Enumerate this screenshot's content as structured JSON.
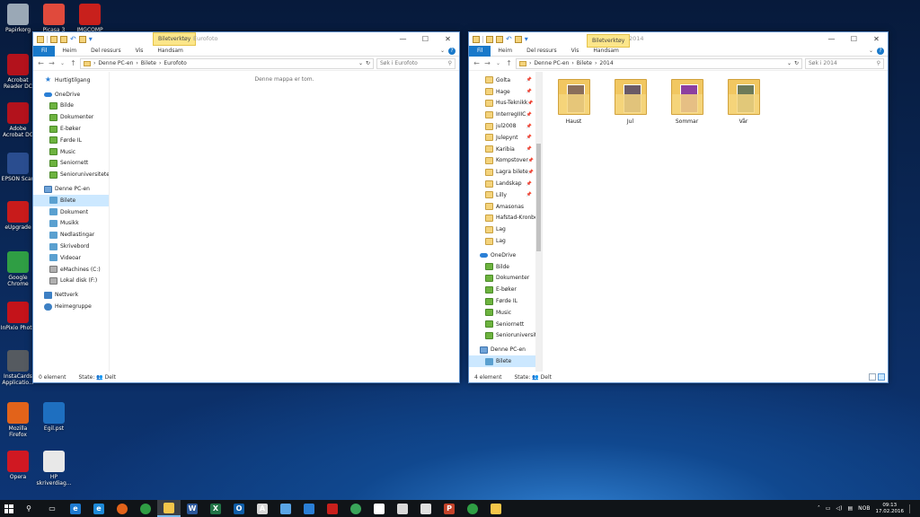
{
  "desktop": {
    "icons": [
      {
        "label": "Papirkorg",
        "color": "#9aa8b6"
      },
      {
        "label": "Picasa 3",
        "color": "#e04a3c"
      },
      {
        "label": "IMGCOMP",
        "color": "#c8201c"
      },
      {
        "label": "Acrobat Reader DC",
        "color": "#b3121c"
      },
      {
        "label": "Adobe Acrobat DC",
        "color": "#b3121c"
      },
      {
        "label": "EPSON Scan",
        "color": "#2a4d8f"
      },
      {
        "label": "eUpgrade",
        "color": "#c81b1b"
      },
      {
        "label": "Google Chrome",
        "color": "#2f9e44"
      },
      {
        "label": "InPixio Photo",
        "color": "#c4131a"
      },
      {
        "label": "InstaCards Applicatio...",
        "color": "#555a60"
      },
      {
        "label": "Mozilla Firefox",
        "color": "#e2631a"
      },
      {
        "label": "Egil.pst",
        "color": "#1e6fc0"
      },
      {
        "label": "Opera",
        "color": "#d01822"
      },
      {
        "label": "HP skriverdiag...",
        "color": "#e8e8e8"
      }
    ]
  },
  "window_left": {
    "title": "Eurofoto",
    "context_tab": "Biletverktøy",
    "ribbon_tabs": [
      "Fil",
      "Heim",
      "Del ressurs",
      "Vis",
      "Handsam"
    ],
    "address_parts": [
      "Denne PC-en",
      "Bilete",
      "Eurofoto"
    ],
    "search_placeholder": "Søk i Eurofoto",
    "empty_message": "Denne mappa er tom.",
    "nav_items": [
      {
        "label": "Hurtigtilgang",
        "icon": "star"
      },
      {
        "label": "OneDrive",
        "icon": "cloud"
      },
      {
        "label": "Bilde",
        "icon": "od"
      },
      {
        "label": "Dokumenter",
        "icon": "od"
      },
      {
        "label": "E-bøker",
        "icon": "od"
      },
      {
        "label": "Førde IL",
        "icon": "od"
      },
      {
        "label": "Music",
        "icon": "od"
      },
      {
        "label": "Seniornett",
        "icon": "od"
      },
      {
        "label": "Senioruniversitetet",
        "icon": "od"
      },
      {
        "label": "Denne PC-en",
        "icon": "pc"
      },
      {
        "label": "Bilete",
        "icon": "lib",
        "selected": true
      },
      {
        "label": "Dokument",
        "icon": "lib"
      },
      {
        "label": "Musikk",
        "icon": "lib"
      },
      {
        "label": "Nedlastingar",
        "icon": "lib"
      },
      {
        "label": "Skrivebord",
        "icon": "lib"
      },
      {
        "label": "Videoar",
        "icon": "lib"
      },
      {
        "label": "eMachines (C:)",
        "icon": "disk"
      },
      {
        "label": "Lokal disk (F:)",
        "icon": "disk"
      },
      {
        "label": "Nettverk",
        "icon": "net"
      },
      {
        "label": "Heimegruppe",
        "icon": "home"
      }
    ],
    "status": {
      "count": "0 element",
      "state": "State: 👥 Delt"
    }
  },
  "window_right": {
    "title": "2014",
    "context_tab": "Biletverktøy",
    "ribbon_tabs": [
      "Fil",
      "Heim",
      "Del ressurs",
      "Vis",
      "Handsam"
    ],
    "address_parts": [
      "Denne PC-en",
      "Bilete",
      "2014"
    ],
    "search_placeholder": "Søk i 2014",
    "nav_items": [
      {
        "label": "Golta",
        "icon": "fold",
        "pinned": true
      },
      {
        "label": "Hage",
        "icon": "fold",
        "pinned": true
      },
      {
        "label": "Hus-Teknikk",
        "icon": "fold",
        "pinned": true
      },
      {
        "label": "InterregIIIC",
        "icon": "fold",
        "pinned": true
      },
      {
        "label": "jul2008",
        "icon": "fold",
        "pinned": true
      },
      {
        "label": "Julepynt",
        "icon": "fold",
        "pinned": true
      },
      {
        "label": "Karibia",
        "icon": "fold",
        "pinned": true
      },
      {
        "label": "Kompstover",
        "icon": "fold",
        "pinned": true
      },
      {
        "label": "Lagra bilete",
        "icon": "fold",
        "pinned": true
      },
      {
        "label": "Landskap",
        "icon": "fold",
        "pinned": true
      },
      {
        "label": "Lilly",
        "icon": "fold",
        "pinned": true
      },
      {
        "label": "Amasonas",
        "icon": "fold"
      },
      {
        "label": "Hafstad-Kronbo",
        "icon": "fold"
      },
      {
        "label": "Lag",
        "icon": "fold"
      },
      {
        "label": "Lag",
        "icon": "fold"
      },
      {
        "label": "OneDrive",
        "icon": "cloud"
      },
      {
        "label": "Bilde",
        "icon": "od"
      },
      {
        "label": "Dokumenter",
        "icon": "od"
      },
      {
        "label": "E-bøker",
        "icon": "od"
      },
      {
        "label": "Førde IL",
        "icon": "od"
      },
      {
        "label": "Music",
        "icon": "od"
      },
      {
        "label": "Seniornett",
        "icon": "od"
      },
      {
        "label": "Senioruniversitet",
        "icon": "od"
      },
      {
        "label": "Denne PC-en",
        "icon": "pc"
      },
      {
        "label": "Bilete",
        "icon": "lib",
        "selected": true
      }
    ],
    "folders": [
      {
        "label": "Haust",
        "photo": "#8a6e5a"
      },
      {
        "label": "Jul",
        "photo": "#6a5a66"
      },
      {
        "label": "Sommar",
        "photo": "#8c3fa0"
      },
      {
        "label": "Vår",
        "photo": "#6d7a58"
      }
    ],
    "status": {
      "count": "4 element",
      "state": "State: 👥 Delt"
    }
  },
  "taskbar": {
    "items": [
      {
        "name": "search",
        "color": "#101418",
        "glyph": "⚲"
      },
      {
        "name": "task-view",
        "color": "#101418",
        "glyph": "▭"
      },
      {
        "name": "edge",
        "color": "#1d7ad0",
        "glyph": "e"
      },
      {
        "name": "internet-explorer",
        "color": "#1e8ad8",
        "glyph": "e"
      },
      {
        "name": "firefox",
        "color": "#e2631a",
        "glyph": ""
      },
      {
        "name": "chrome",
        "color": "#2f9e44",
        "glyph": ""
      },
      {
        "name": "file-explorer",
        "color": "#f4c64a",
        "glyph": "",
        "active": true
      },
      {
        "name": "word",
        "color": "#2b579a",
        "glyph": "W"
      },
      {
        "name": "excel",
        "color": "#217346",
        "glyph": "X"
      },
      {
        "name": "outlook",
        "color": "#0f5ea8",
        "glyph": "O"
      },
      {
        "name": "acrobat",
        "color": "#d8d8d8",
        "glyph": "A"
      },
      {
        "name": "picasa",
        "color": "#5aa5e6",
        "glyph": ""
      },
      {
        "name": "phone-companion",
        "color": "#2a7fd6",
        "glyph": ""
      },
      {
        "name": "imgcomp",
        "color": "#c8201c",
        "glyph": ""
      },
      {
        "name": "greenshot",
        "color": "#3aa55a",
        "glyph": ""
      },
      {
        "name": "settings",
        "color": "#ffffff",
        "glyph": ""
      },
      {
        "name": "store",
        "color": "#d9d9d9",
        "glyph": ""
      },
      {
        "name": "calendar",
        "color": "#e0e0e0",
        "glyph": ""
      },
      {
        "name": "powerpoint",
        "color": "#c4432a",
        "glyph": "P"
      },
      {
        "name": "chrome-2",
        "color": "#2f9e44",
        "glyph": ""
      },
      {
        "name": "notepad",
        "color": "#f4c64a",
        "glyph": ""
      }
    ],
    "tray": {
      "lang": "NOB",
      "time": "09:13",
      "date": "17.02.2016"
    }
  }
}
